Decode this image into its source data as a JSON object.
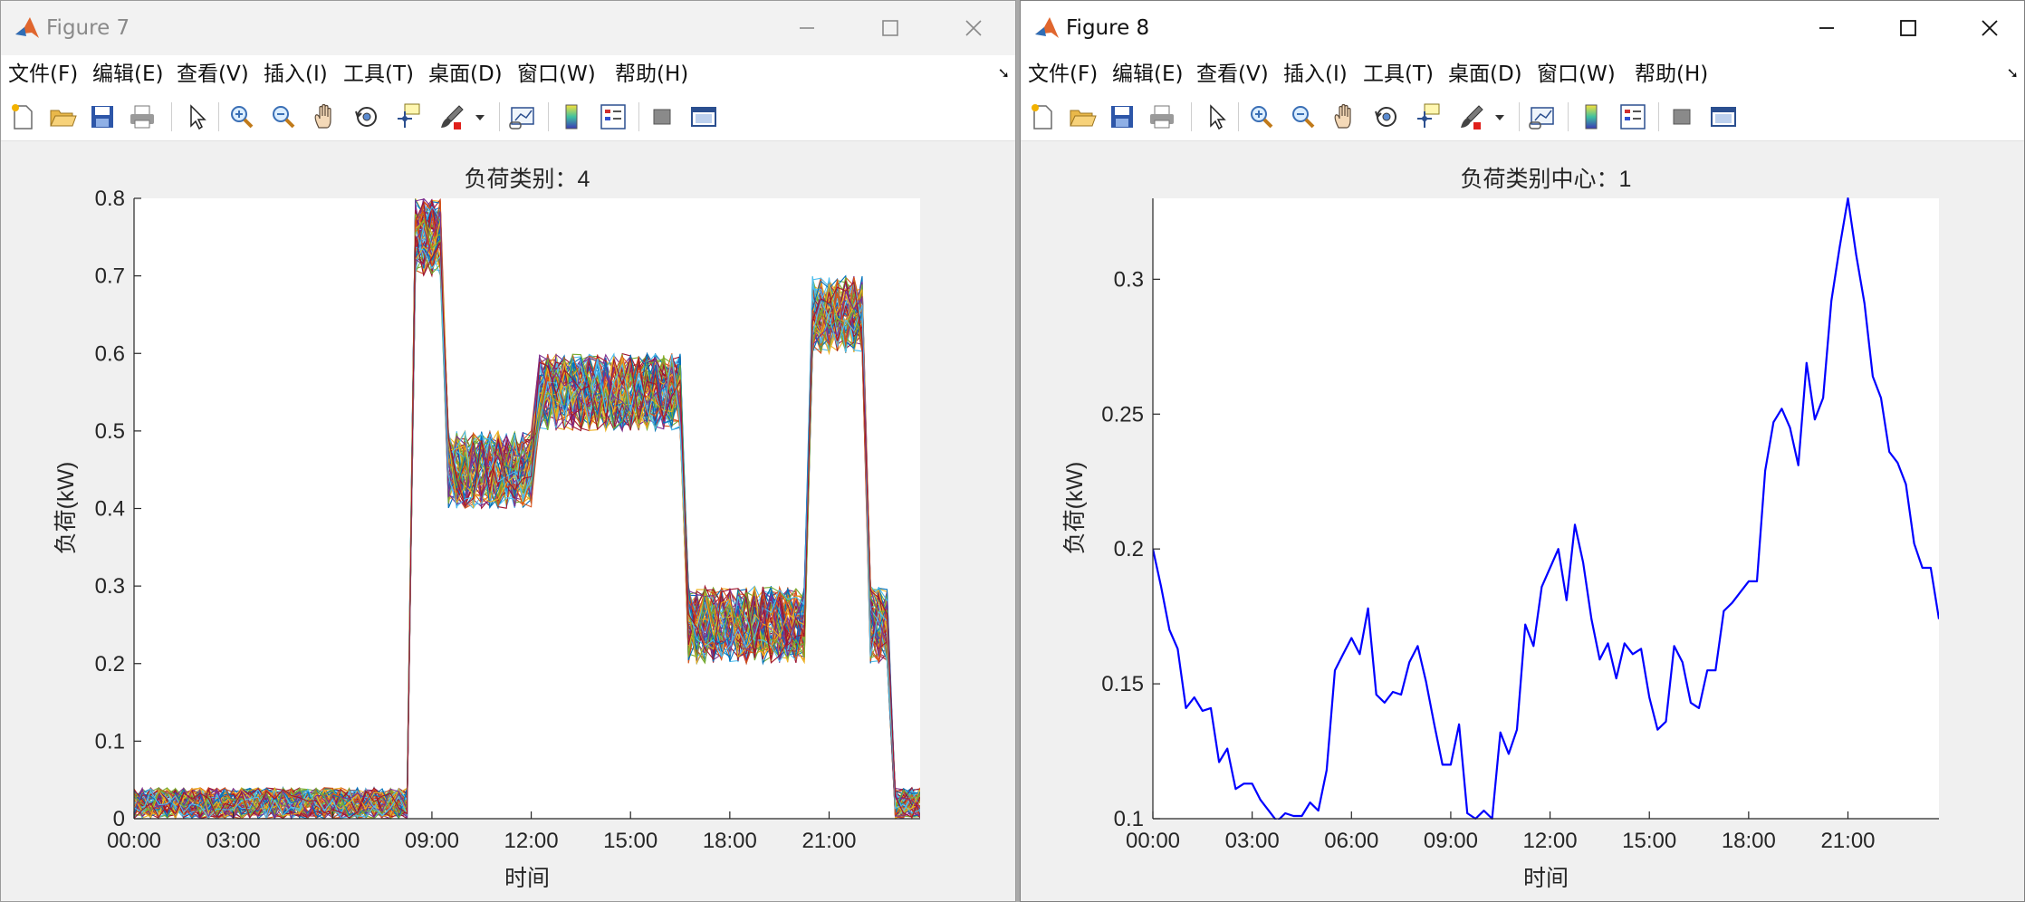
{
  "figure7": {
    "title": "Figure 7",
    "menu": [
      "文件(F)",
      "编辑(E)",
      "查看(V)",
      "插入(I)",
      "工具(T)",
      "桌面(D)",
      "窗口(W)",
      "帮助(H)"
    ],
    "plot_title": "负荷类别：4",
    "chart_data": {
      "type": "line",
      "title": "负荷类别：4",
      "xlabel": "时间",
      "ylabel": "负荷(kW)",
      "x_ticks": [
        "00:00",
        "03:00",
        "06:00",
        "09:00",
        "12:00",
        "15:00",
        "18:00",
        "21:00"
      ],
      "y_ticks": [
        "0",
        "0.1",
        "0.2",
        "0.3",
        "0.4",
        "0.5",
        "0.6",
        "0.7",
        "0.8"
      ],
      "ylim": [
        0,
        0.8
      ],
      "x_range_hours": [
        0,
        23.75
      ],
      "legend": "none",
      "grid": false,
      "series_count": "many (overlapping load profiles, multicolor)",
      "bands": [
        {
          "from": "00:00",
          "to": "08:15",
          "low": 0.0,
          "high": 0.04
        },
        {
          "from": "08:30",
          "to": "09:15",
          "low": 0.7,
          "high": 0.8
        },
        {
          "from": "09:30",
          "to": "12:00",
          "low": 0.4,
          "high": 0.5
        },
        {
          "from": "12:15",
          "to": "16:30",
          "low": 0.5,
          "high": 0.6
        },
        {
          "from": "16:45",
          "to": "20:15",
          "low": 0.2,
          "high": 0.3
        },
        {
          "from": "20:30",
          "to": "22:00",
          "low": 0.6,
          "high": 0.7
        },
        {
          "from": "22:15",
          "to": "22:45",
          "low": 0.2,
          "high": 0.3
        },
        {
          "from": "23:00",
          "to": "23:45",
          "low": 0.0,
          "high": 0.04
        }
      ]
    }
  },
  "figure8": {
    "title": "Figure 8",
    "menu": [
      "文件(F)",
      "编辑(E)",
      "查看(V)",
      "插入(I)",
      "工具(T)",
      "桌面(D)",
      "窗口(W)",
      "帮助(H)"
    ],
    "plot_title": "负荷类别中心：1",
    "chart_data": {
      "type": "line",
      "title": "负荷类别中心：1",
      "xlabel": "时间",
      "ylabel": "负荷(kW)",
      "x_ticks": [
        "00:00",
        "03:00",
        "06:00",
        "09:00",
        "12:00",
        "15:00",
        "18:00",
        "21:00"
      ],
      "y_ticks": [
        "0.1",
        "0.15",
        "0.2",
        "0.25",
        "0.3"
      ],
      "ylim": [
        0.1,
        0.33
      ],
      "grid": false,
      "legend": "none",
      "color": "#0000ff",
      "x_step_minutes": 15,
      "values": [
        0.2,
        0.186,
        0.17,
        0.163,
        0.141,
        0.145,
        0.14,
        0.141,
        0.121,
        0.126,
        0.111,
        0.113,
        0.113,
        0.107,
        0.103,
        0.099,
        0.102,
        0.101,
        0.101,
        0.106,
        0.103,
        0.118,
        0.155,
        0.161,
        0.167,
        0.161,
        0.178,
        0.146,
        0.143,
        0.147,
        0.146,
        0.158,
        0.164,
        0.151,
        0.135,
        0.12,
        0.12,
        0.135,
        0.102,
        0.1,
        0.103,
        0.1,
        0.132,
        0.124,
        0.133,
        0.172,
        0.164,
        0.186,
        0.193,
        0.2,
        0.181,
        0.209,
        0.195,
        0.174,
        0.159,
        0.165,
        0.152,
        0.165,
        0.161,
        0.163,
        0.145,
        0.133,
        0.136,
        0.164,
        0.158,
        0.143,
        0.141,
        0.155,
        0.155,
        0.177,
        0.18,
        0.184,
        0.188,
        0.188,
        0.229,
        0.247,
        0.252,
        0.245,
        0.231,
        0.269,
        0.248,
        0.256,
        0.292,
        0.312,
        0.33,
        0.309,
        0.291,
        0.264,
        0.256,
        0.236,
        0.232,
        0.224,
        0.202,
        0.193,
        0.193,
        0.174
      ]
    }
  }
}
